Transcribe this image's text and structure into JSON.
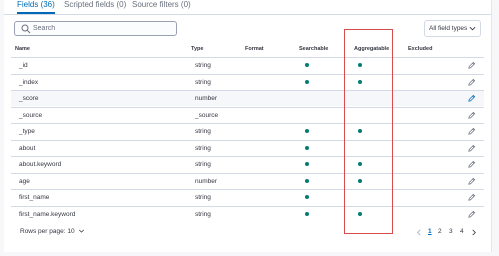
{
  "tabs": [
    {
      "label": "Fields (36)",
      "active": true
    },
    {
      "label": "Scripted fields (0)",
      "active": false
    },
    {
      "label": "Source filters (0)",
      "active": false
    }
  ],
  "search": {
    "placeholder": "Search",
    "value": ""
  },
  "filter": {
    "label": "All field types"
  },
  "columns": [
    "Name",
    "Type",
    "Format",
    "Searchable",
    "Aggregatable",
    "Excluded"
  ],
  "rows": [
    {
      "name": "_id",
      "type": "string",
      "searchable": true,
      "aggregatable": true,
      "highlight": false
    },
    {
      "name": "_index",
      "type": "string",
      "searchable": true,
      "aggregatable": true,
      "highlight": false
    },
    {
      "name": "_score",
      "type": "number",
      "searchable": false,
      "aggregatable": false,
      "highlight": true
    },
    {
      "name": "_source",
      "type": "_source",
      "searchable": false,
      "aggregatable": false,
      "highlight": false
    },
    {
      "name": "_type",
      "type": "string",
      "searchable": true,
      "aggregatable": true,
      "highlight": false
    },
    {
      "name": "about",
      "type": "string",
      "searchable": true,
      "aggregatable": false,
      "highlight": false
    },
    {
      "name": "about.keyword",
      "type": "string",
      "searchable": true,
      "aggregatable": true,
      "highlight": false
    },
    {
      "name": "age",
      "type": "number",
      "searchable": true,
      "aggregatable": true,
      "highlight": false
    },
    {
      "name": "first_name",
      "type": "string",
      "searchable": true,
      "aggregatable": false,
      "highlight": false
    },
    {
      "name": "first_name.keyword",
      "type": "string",
      "searchable": true,
      "aggregatable": true,
      "highlight": false
    }
  ],
  "footer": {
    "rows_per_page": "Rows per page: 10",
    "pages": [
      "1",
      "2",
      "3",
      "4"
    ],
    "current_page": "1"
  },
  "colors": {
    "accent": "#006bb4",
    "dot": "#017d73",
    "annotation": "#d94c4c"
  }
}
